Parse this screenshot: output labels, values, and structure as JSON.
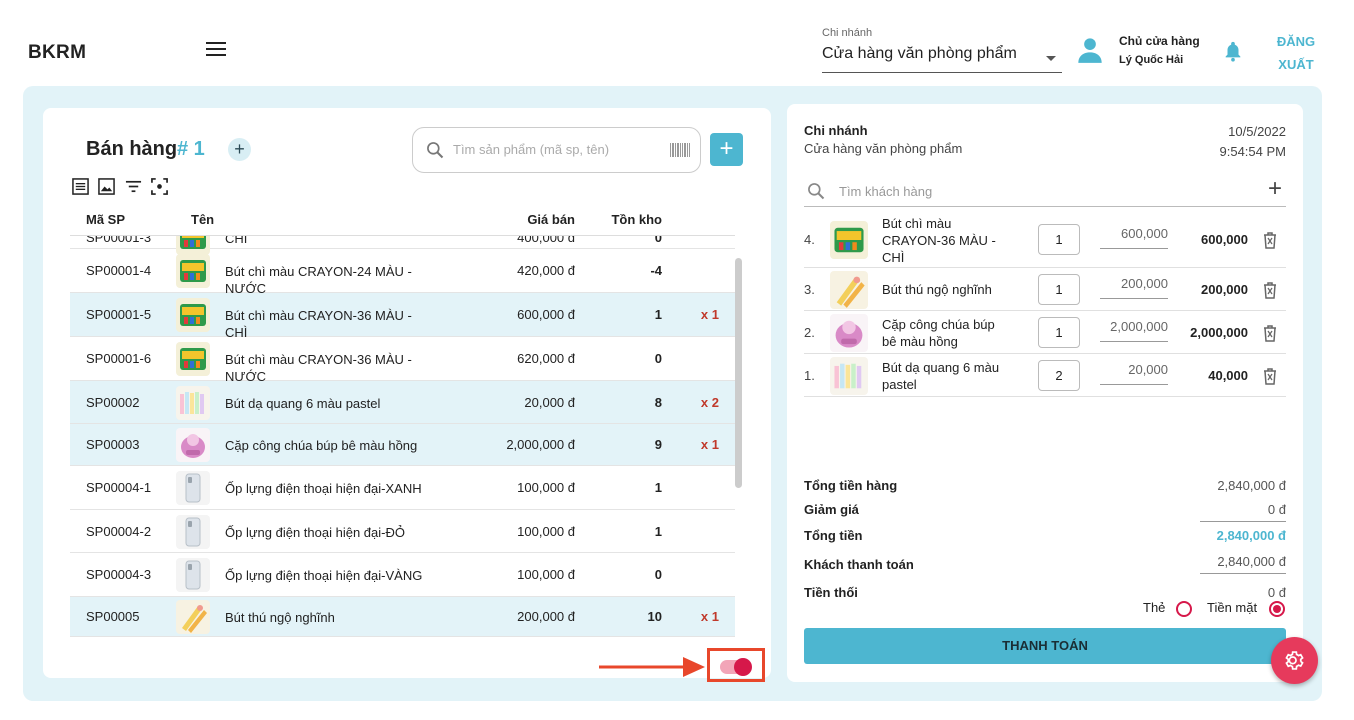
{
  "header": {
    "logo": "BKRM",
    "branch_label": "Chi nhánh",
    "branch_value": "Cửa hàng văn phòng phẩm",
    "user_role": "Chủ cửa hàng",
    "user_name": "Lý Quốc Hải",
    "logout_line1": "ĐĂNG",
    "logout_line2": "XUẤT"
  },
  "sale": {
    "title": "Bán hàng",
    "invoice_no": "# 1",
    "add_tab": "+",
    "search_placeholder": "Tìm sản phẩm (mã sp, tên)",
    "add_product": "+"
  },
  "table": {
    "headers": {
      "code": "Mã SP",
      "name": "Tên",
      "price": "Giá bán",
      "stock": "Tồn kho"
    },
    "rows": [
      {
        "code": "SP00001-3",
        "name": "CHÌ",
        "price": "400,000 đ",
        "stock": "0",
        "qty": "",
        "selected": false,
        "img": "crayon"
      },
      {
        "code": "SP00001-4",
        "name": "Bút chì màu CRAYON-24 MÀU - NƯỚC",
        "price": "420,000 đ",
        "stock": "-4",
        "qty": "",
        "selected": false,
        "img": "crayon"
      },
      {
        "code": "SP00001-5",
        "name": "Bút chì màu CRAYON-36 MÀU - CHÌ",
        "price": "600,000 đ",
        "stock": "1",
        "qty": "x 1",
        "selected": true,
        "img": "crayon"
      },
      {
        "code": "SP00001-6",
        "name": "Bút chì màu CRAYON-36 MÀU - NƯỚC",
        "price": "620,000 đ",
        "stock": "0",
        "qty": "",
        "selected": false,
        "img": "crayon"
      },
      {
        "code": "SP00002",
        "name": "Bút dạ quang 6 màu pastel",
        "price": "20,000 đ",
        "stock": "8",
        "qty": "x 2",
        "selected": true,
        "img": "pastel"
      },
      {
        "code": "SP00003",
        "name": "Cặp công chúa búp bê màu hồng",
        "price": "2,000,000 đ",
        "stock": "9",
        "qty": "x 1",
        "selected": true,
        "img": "bag"
      },
      {
        "code": "SP00004-1",
        "name": "Ốp lựng điện thoại hiện đại-XANH",
        "price": "100,000 đ",
        "stock": "1",
        "qty": "",
        "selected": false,
        "img": "phone"
      },
      {
        "code": "SP00004-2",
        "name": "Ốp lựng điện thoại hiện đại-ĐỎ",
        "price": "100,000 đ",
        "stock": "1",
        "qty": "",
        "selected": false,
        "img": "phone"
      },
      {
        "code": "SP00004-3",
        "name": "Ốp lựng điện thoại hiện đại-VÀNG",
        "price": "100,000 đ",
        "stock": "0",
        "qty": "",
        "selected": false,
        "img": "phone"
      },
      {
        "code": "SP00005",
        "name": "Bút thú ngộ nghĩnh",
        "price": "200,000 đ",
        "stock": "10",
        "qty": "x 1",
        "selected": true,
        "img": "pens"
      }
    ]
  },
  "invoice": {
    "branch_label": "Chi nhánh",
    "branch_value": "Cửa hàng văn phòng phẩm",
    "date": "10/5/2022",
    "time": "9:54:54 PM",
    "customer_placeholder": "Tìm khách hàng",
    "items": [
      {
        "index": "4.",
        "name": "Bút chì màu CRAYON-36 MÀU - CHÌ",
        "qty": "1",
        "unit_price": "600,000",
        "subtotal": "600,000",
        "img": "crayon"
      },
      {
        "index": "3.",
        "name": "Bút thú ngộ nghĩnh",
        "qty": "1",
        "unit_price": "200,000",
        "subtotal": "200,000",
        "img": "pens"
      },
      {
        "index": "2.",
        "name": "Cặp công chúa búp bê màu hồng",
        "qty": "1",
        "unit_price": "2,000,000",
        "subtotal": "2,000,000",
        "img": "bag"
      },
      {
        "index": "1.",
        "name": "Bút dạ quang 6 màu pastel",
        "qty": "2",
        "unit_price": "20,000",
        "subtotal": "40,000",
        "img": "pastel"
      }
    ],
    "summary": {
      "goods_label": "Tổng tiền hàng",
      "goods_value": "2,840,000 đ",
      "discount_label": "Giảm giá",
      "discount_value": "0 đ",
      "total_label": "Tổng tiền",
      "total_value": "2,840,000 đ",
      "paid_label": "Khách thanh toán",
      "paid_value": "2,840,000 đ",
      "change_label": "Tiền thối",
      "change_value": "0 đ"
    },
    "pay_card": "Thẻ",
    "pay_cash": "Tiền mặt",
    "pay_button": "THANH TOÁN"
  },
  "colors": {
    "accent": "#4db6d0",
    "panel": "#e2f3f8",
    "highlight": "#e3f3f8",
    "danger": "#d6184a",
    "fab": "#e63a5c",
    "annotation": "#e8472b"
  },
  "icons": [
    "menu-icon",
    "user-icon",
    "bell-icon",
    "search-icon",
    "barcode-icon",
    "list-view-icon",
    "image-view-icon",
    "filter-icon",
    "scan-icon",
    "trash-icon",
    "settings-icon"
  ]
}
